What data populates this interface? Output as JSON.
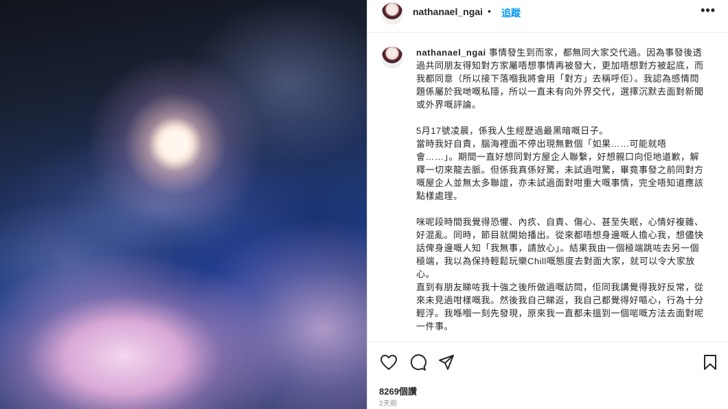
{
  "post": {
    "username": "nathanael_ngai",
    "separator": "•",
    "follow_label": "追蹤",
    "more_label": "•••",
    "caption_intro": "事情發生到而家，都無同大家交代過。因為事發後透過共同朋友得知對方家屬唔想事情再被發大，更加唔想對方被起底，而我都同意（所以接下落嗰我將會用「對方」去稱呼佢）。我認為感情問題係屬於我哋嘅私隱，所以一直未有向外界交代，選擇沉默去面對新聞或外界嘅評論。",
    "paragraphs": [
      "5月17號凌晨，係我人生經歷過最黑暗嘅日子。\n當時我好自責，腦海裡面不停出現無數個「如果……可能就唔會……」。期間一直好想同對方屋企人聯繫，好想親口向佢地道歉，解釋一切來龍去脈。但係我真係好驚，未試過咁驚，畢竟事發之前同對方嘅屋企人並無太多聯誼，亦未試過面對咁重大嘅事情，完全唔知道應該點樣處理。",
      "咪呢段時間我覺得恐懼、內疚、自責、傷心、甚至失眠，心情好複雜、好混亂。同時，節目就開始播出。從來都唔想身邊嘅人擔心我，想儘快話俾身邊嘅人知「我無事，請放心」。結果我由一個極端跳咗去另一個極端，我以為保持輕鬆玩樂Chill嘅態度去對面大家，就可以令大家放心。\n直到有朋友睇咗我十強之後所做過嘅訪問，佢同我講覺得我好反常，從來未見過咁樣嘅我。然後我自己睇返，我自己都覺得好嘔心，行為十分輕浮。我喺嗰一刻先發現，原來我一直都未搵到一個啱嘅方法去面對呢一件事。"
    ],
    "likes": "8269個讚",
    "time": "2天前"
  },
  "icons": {
    "heart": "heart-icon",
    "comment": "comment-icon",
    "share": "share-icon",
    "save": "bookmark-icon"
  },
  "colors": {
    "accent": "#0095f6",
    "text": "#262626",
    "muted": "#8e8e8e"
  }
}
